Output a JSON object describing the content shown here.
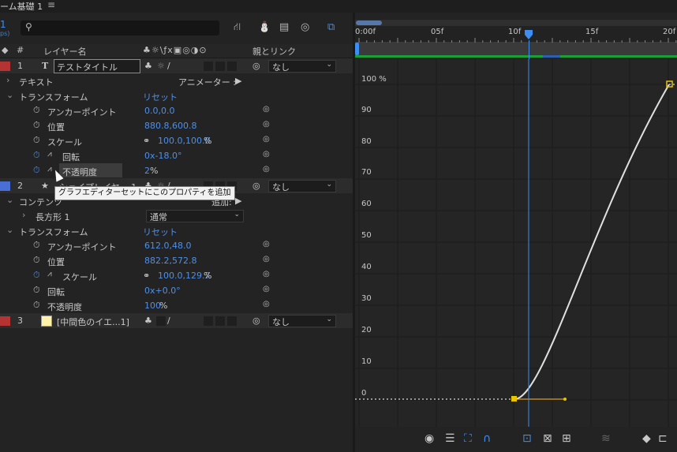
{
  "window": {
    "comp_title": "ーム基礎 1",
    "menu_icon": "menu-icon"
  },
  "timecode": {
    "value": "1",
    "sub": "ps)"
  },
  "search": {
    "placeholder": ""
  },
  "columns": {
    "num": "#",
    "layer_name": "レイヤー名",
    "parent": "親とリンク"
  },
  "rows": [
    {
      "id": "layer1",
      "num": "1",
      "type": "T",
      "name": "テストタイトル",
      "parent": "なし",
      "color": "#b53333"
    },
    {
      "id": "text",
      "label": "テキスト",
      "animator": "アニメーター :"
    },
    {
      "id": "transform1",
      "label": "トランスフォーム",
      "reset": "リセット"
    },
    {
      "id": "anchor1",
      "label": "アンカーポイント",
      "value": "0.0,0.0"
    },
    {
      "id": "position1",
      "label": "位置",
      "value": "880.8,600.8"
    },
    {
      "id": "scale1",
      "label": "スケール",
      "value": "100.0,100.0",
      "unit": "%"
    },
    {
      "id": "rotation1",
      "label": "回転",
      "value": "0x-18.0°"
    },
    {
      "id": "opacity1",
      "label": "不透明度",
      "value": "2",
      "unit": "%"
    },
    {
      "id": "layer2",
      "num": "2",
      "name": "シェイプレイヤー 1",
      "parent": "なし",
      "color": "#4a6fd4"
    },
    {
      "id": "contents",
      "label": "コンテンツ",
      "add": "追加:"
    },
    {
      "id": "rect1",
      "label": "長方形 1",
      "mode": "通常"
    },
    {
      "id": "transform2",
      "label": "トランスフォーム",
      "reset": "リセット"
    },
    {
      "id": "anchor2",
      "label": "アンカーポイント",
      "value": "612.0,48.0"
    },
    {
      "id": "position2",
      "label": "位置",
      "value": "882.2,572.8"
    },
    {
      "id": "scale2",
      "label": "スケール",
      "value": "100.0,129.7",
      "unit": "%"
    },
    {
      "id": "rotation2",
      "label": "回転",
      "value": "0x+0.0°"
    },
    {
      "id": "opacity2",
      "label": "不透明度",
      "value": "100",
      "unit": "%"
    },
    {
      "id": "layer3",
      "num": "3",
      "name": "[中間色のイエ...1]",
      "parent": "なし",
      "color": "#b53333"
    }
  ],
  "tooltip": "グラフエディターセットにこのプロパティを追加",
  "ruler": {
    "labels": [
      "0:00f",
      "05f",
      "10f",
      "15f",
      "20f"
    ]
  },
  "graph": {
    "y_labels": [
      "100 %",
      "90",
      "80",
      "70",
      "60",
      "50",
      "40",
      "30",
      "20",
      "10",
      "0"
    ],
    "curve_color": "#e0e0e0",
    "handle_color": "#e8c400",
    "playhead_color": "#3d8ef0"
  }
}
